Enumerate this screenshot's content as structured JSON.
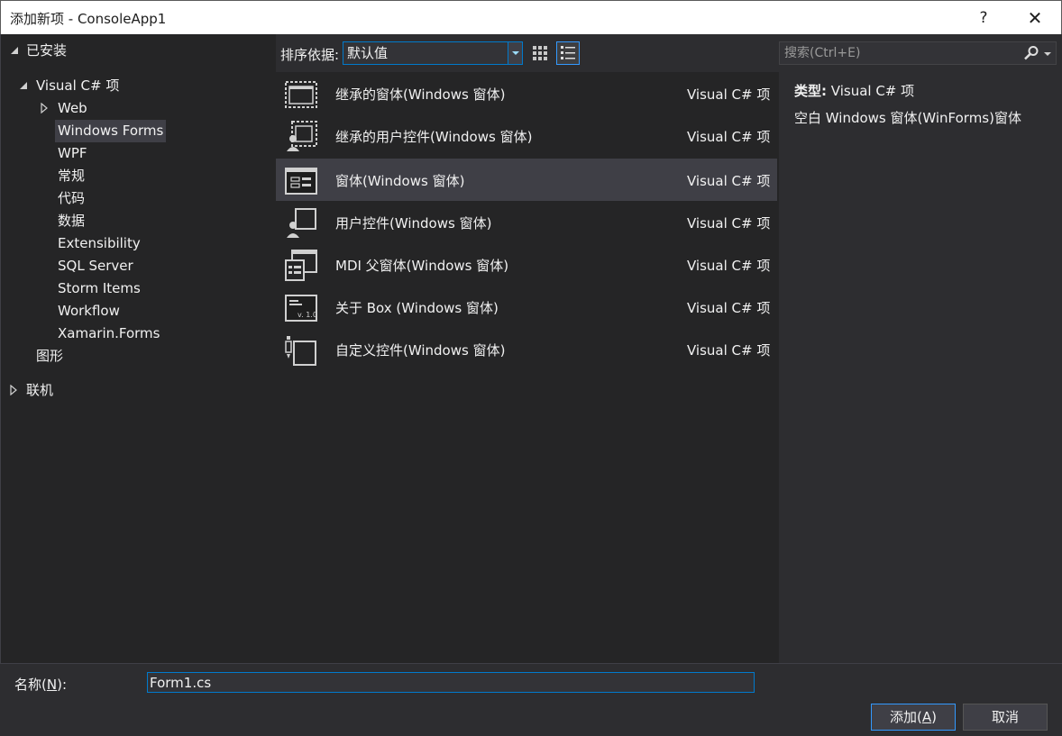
{
  "window": {
    "title": "添加新项 - ConsoleApp1",
    "help_glyph": "?",
    "close_glyph": "✕"
  },
  "tree": {
    "installed": "已安装",
    "visual_cs": "Visual C# 项",
    "children": [
      "Web",
      "Windows Forms",
      "WPF",
      "常规",
      "代码",
      "数据",
      "Extensibility",
      "SQL Server",
      "Storm Items",
      "Workflow",
      "Xamarin.Forms"
    ],
    "graphics": "图形",
    "online": "联机"
  },
  "sort": {
    "label": "排序依据:",
    "value": "默认值"
  },
  "templates": [
    {
      "name": "继承的窗体(Windows 窗体)",
      "lang": "Visual C# 项",
      "icon": "inherited-form-icon"
    },
    {
      "name": "继承的用户控件(Windows 窗体)",
      "lang": "Visual C# 项",
      "icon": "inherited-user-control-icon"
    },
    {
      "name": "窗体(Windows 窗体)",
      "lang": "Visual C# 项",
      "icon": "form-icon"
    },
    {
      "name": "用户控件(Windows 窗体)",
      "lang": "Visual C# 项",
      "icon": "user-control-icon"
    },
    {
      "name": "MDI 父窗体(Windows 窗体)",
      "lang": "Visual C# 项",
      "icon": "mdi-parent-form-icon"
    },
    {
      "name": "关于 Box (Windows 窗体)",
      "lang": "Visual C# 项",
      "icon": "about-box-icon"
    },
    {
      "name": "自定义控件(Windows 窗体)",
      "lang": "Visual C# 项",
      "icon": "custom-control-icon"
    }
  ],
  "search": {
    "placeholder": "搜索(Ctrl+E)"
  },
  "info": {
    "type_label": "类型:",
    "type_value": "Visual C# 项",
    "description": "空白 Windows 窗体(WinForms)窗体"
  },
  "footer": {
    "name_label_prefix": "名称(",
    "name_label_key": "N",
    "name_label_suffix": "):",
    "name_value": "Form1.cs",
    "add_prefix": "添加(",
    "add_key": "A",
    "add_suffix": ")",
    "cancel_label": "取消"
  },
  "colors": {
    "background": "#2d2d30",
    "panel": "#252526",
    "selection": "#3f3f46",
    "accent": "#007acc"
  }
}
